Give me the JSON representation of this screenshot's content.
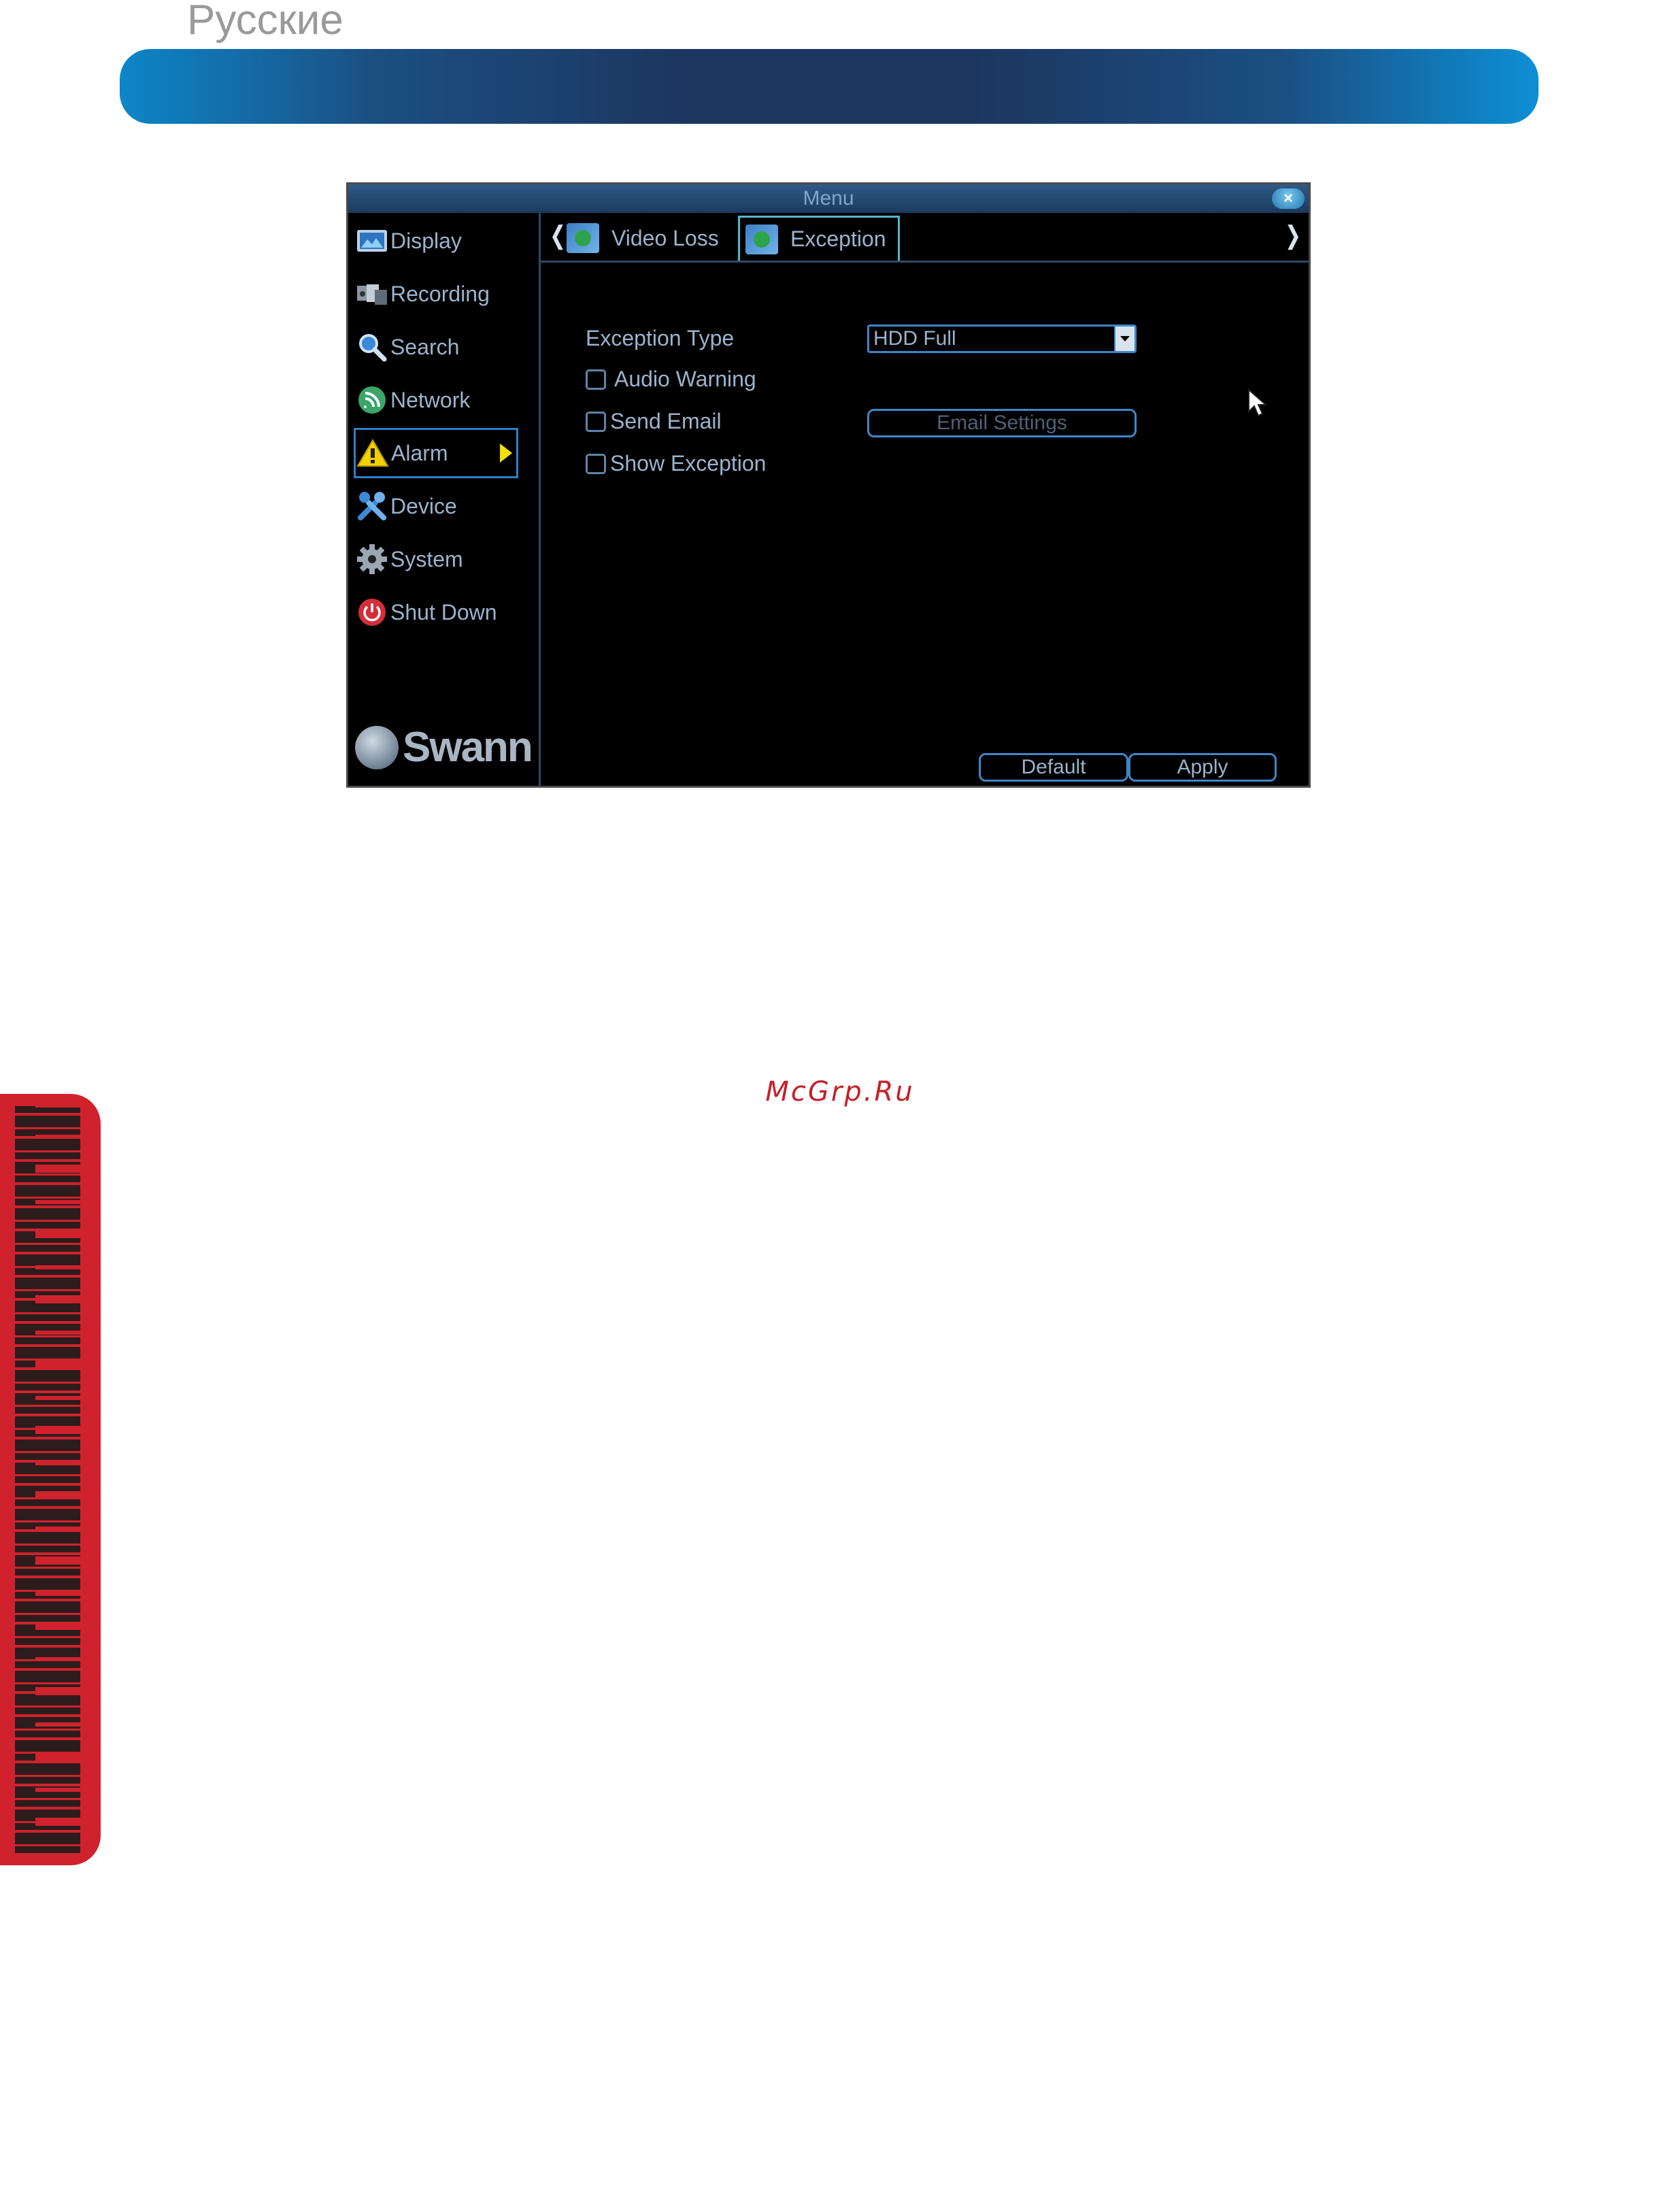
{
  "page": {
    "language_label": "Русские",
    "watermark": "McGrp.Ru"
  },
  "dvr": {
    "window_title": "Menu",
    "close_symbol": "×",
    "brand": "Swann",
    "sidebar": [
      {
        "label": "Display",
        "icon": "display-icon"
      },
      {
        "label": "Recording",
        "icon": "recording-icon"
      },
      {
        "label": "Search",
        "icon": "search-icon"
      },
      {
        "label": "Network",
        "icon": "network-icon"
      },
      {
        "label": "Alarm",
        "icon": "alarm-warning-icon",
        "active": true
      },
      {
        "label": "Device",
        "icon": "device-tools-icon"
      },
      {
        "label": "System",
        "icon": "system-gear-icon"
      },
      {
        "label": "Shut Down",
        "icon": "power-icon"
      }
    ],
    "tabs": {
      "prev_symbol": "❬",
      "next_symbol": "❭",
      "items": [
        {
          "label": "Video Loss",
          "active": false
        },
        {
          "label": "Exception",
          "active": true
        }
      ]
    },
    "form": {
      "exception_type_label": "Exception Type",
      "exception_type_value": "HDD Full",
      "audio_warning_label": "Audio Warning",
      "send_email_label": "Send Email",
      "show_exception_label": "Show Exception",
      "email_settings_label": "Email Settings",
      "default_label": "Default",
      "apply_label": "Apply"
    },
    "colors": {
      "accent": "#3f86c8",
      "alarm_arrow": "#f2e200",
      "text": "#9bb3cc"
    }
  }
}
